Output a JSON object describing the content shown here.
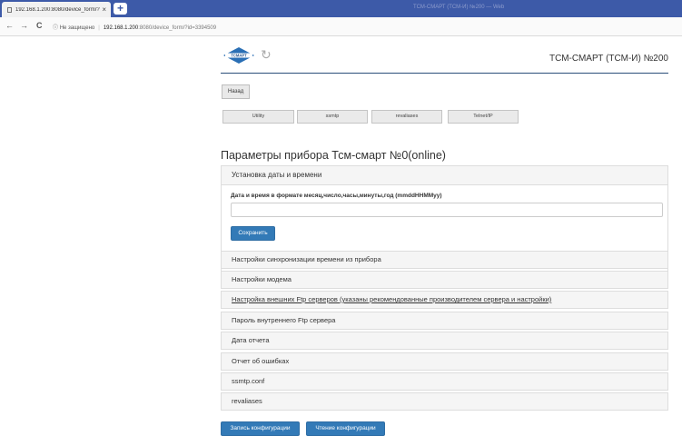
{
  "browser": {
    "tab_title": "192.168.1.200:8080/device_form/?",
    "tab_close": "×",
    "new_tab": "+",
    "window_title": "ТСМ-СМАРТ (ТСМ-И) №200 — Web",
    "back_arrow": "←",
    "forward_arrow": "→",
    "reload": "C",
    "security_icon": "ⓘ",
    "security_text": "Не защищено",
    "url_host": "192.168.1.200",
    "url_path": ":8080/device_form/?id=3394509"
  },
  "header": {
    "logo_text": "ТСМАРТ",
    "reload_icon": "↻",
    "brand_title": "ТСМ-СМАРТ (ТСМ-И) №200"
  },
  "back_button": "Назад",
  "tool_buttons": [
    "Utility",
    "ssmtp",
    "revaliases",
    "Telnet/IP"
  ],
  "page_title": "Параметры прибора Тсм-смарт №0(online)",
  "date_panel": {
    "title": "Установка даты и времени",
    "label": "Дата и время в формате месяц,число,часы,минуты,год (mmddHHMMyy)",
    "value": "",
    "save_label": "Сохранить"
  },
  "sections": [
    "Настройки синхронизации времени из прибора",
    "Настройки модема",
    "Настройка внешних Ftp серверов (указаны рекомендованные производителем сервера и настройки)",
    "Пароль внутреннего Ftp сервера",
    "Дата отчета",
    "Отчет об ошибках",
    "ssmtp.conf",
    "revaliases"
  ],
  "actions": {
    "write_config": "Запись конфигурации",
    "read_config": "Чтение конфигурации"
  },
  "colors": {
    "primary": "#337ab7",
    "tab_bar": "#3d5aa8",
    "rule": "#2b4e7a"
  }
}
